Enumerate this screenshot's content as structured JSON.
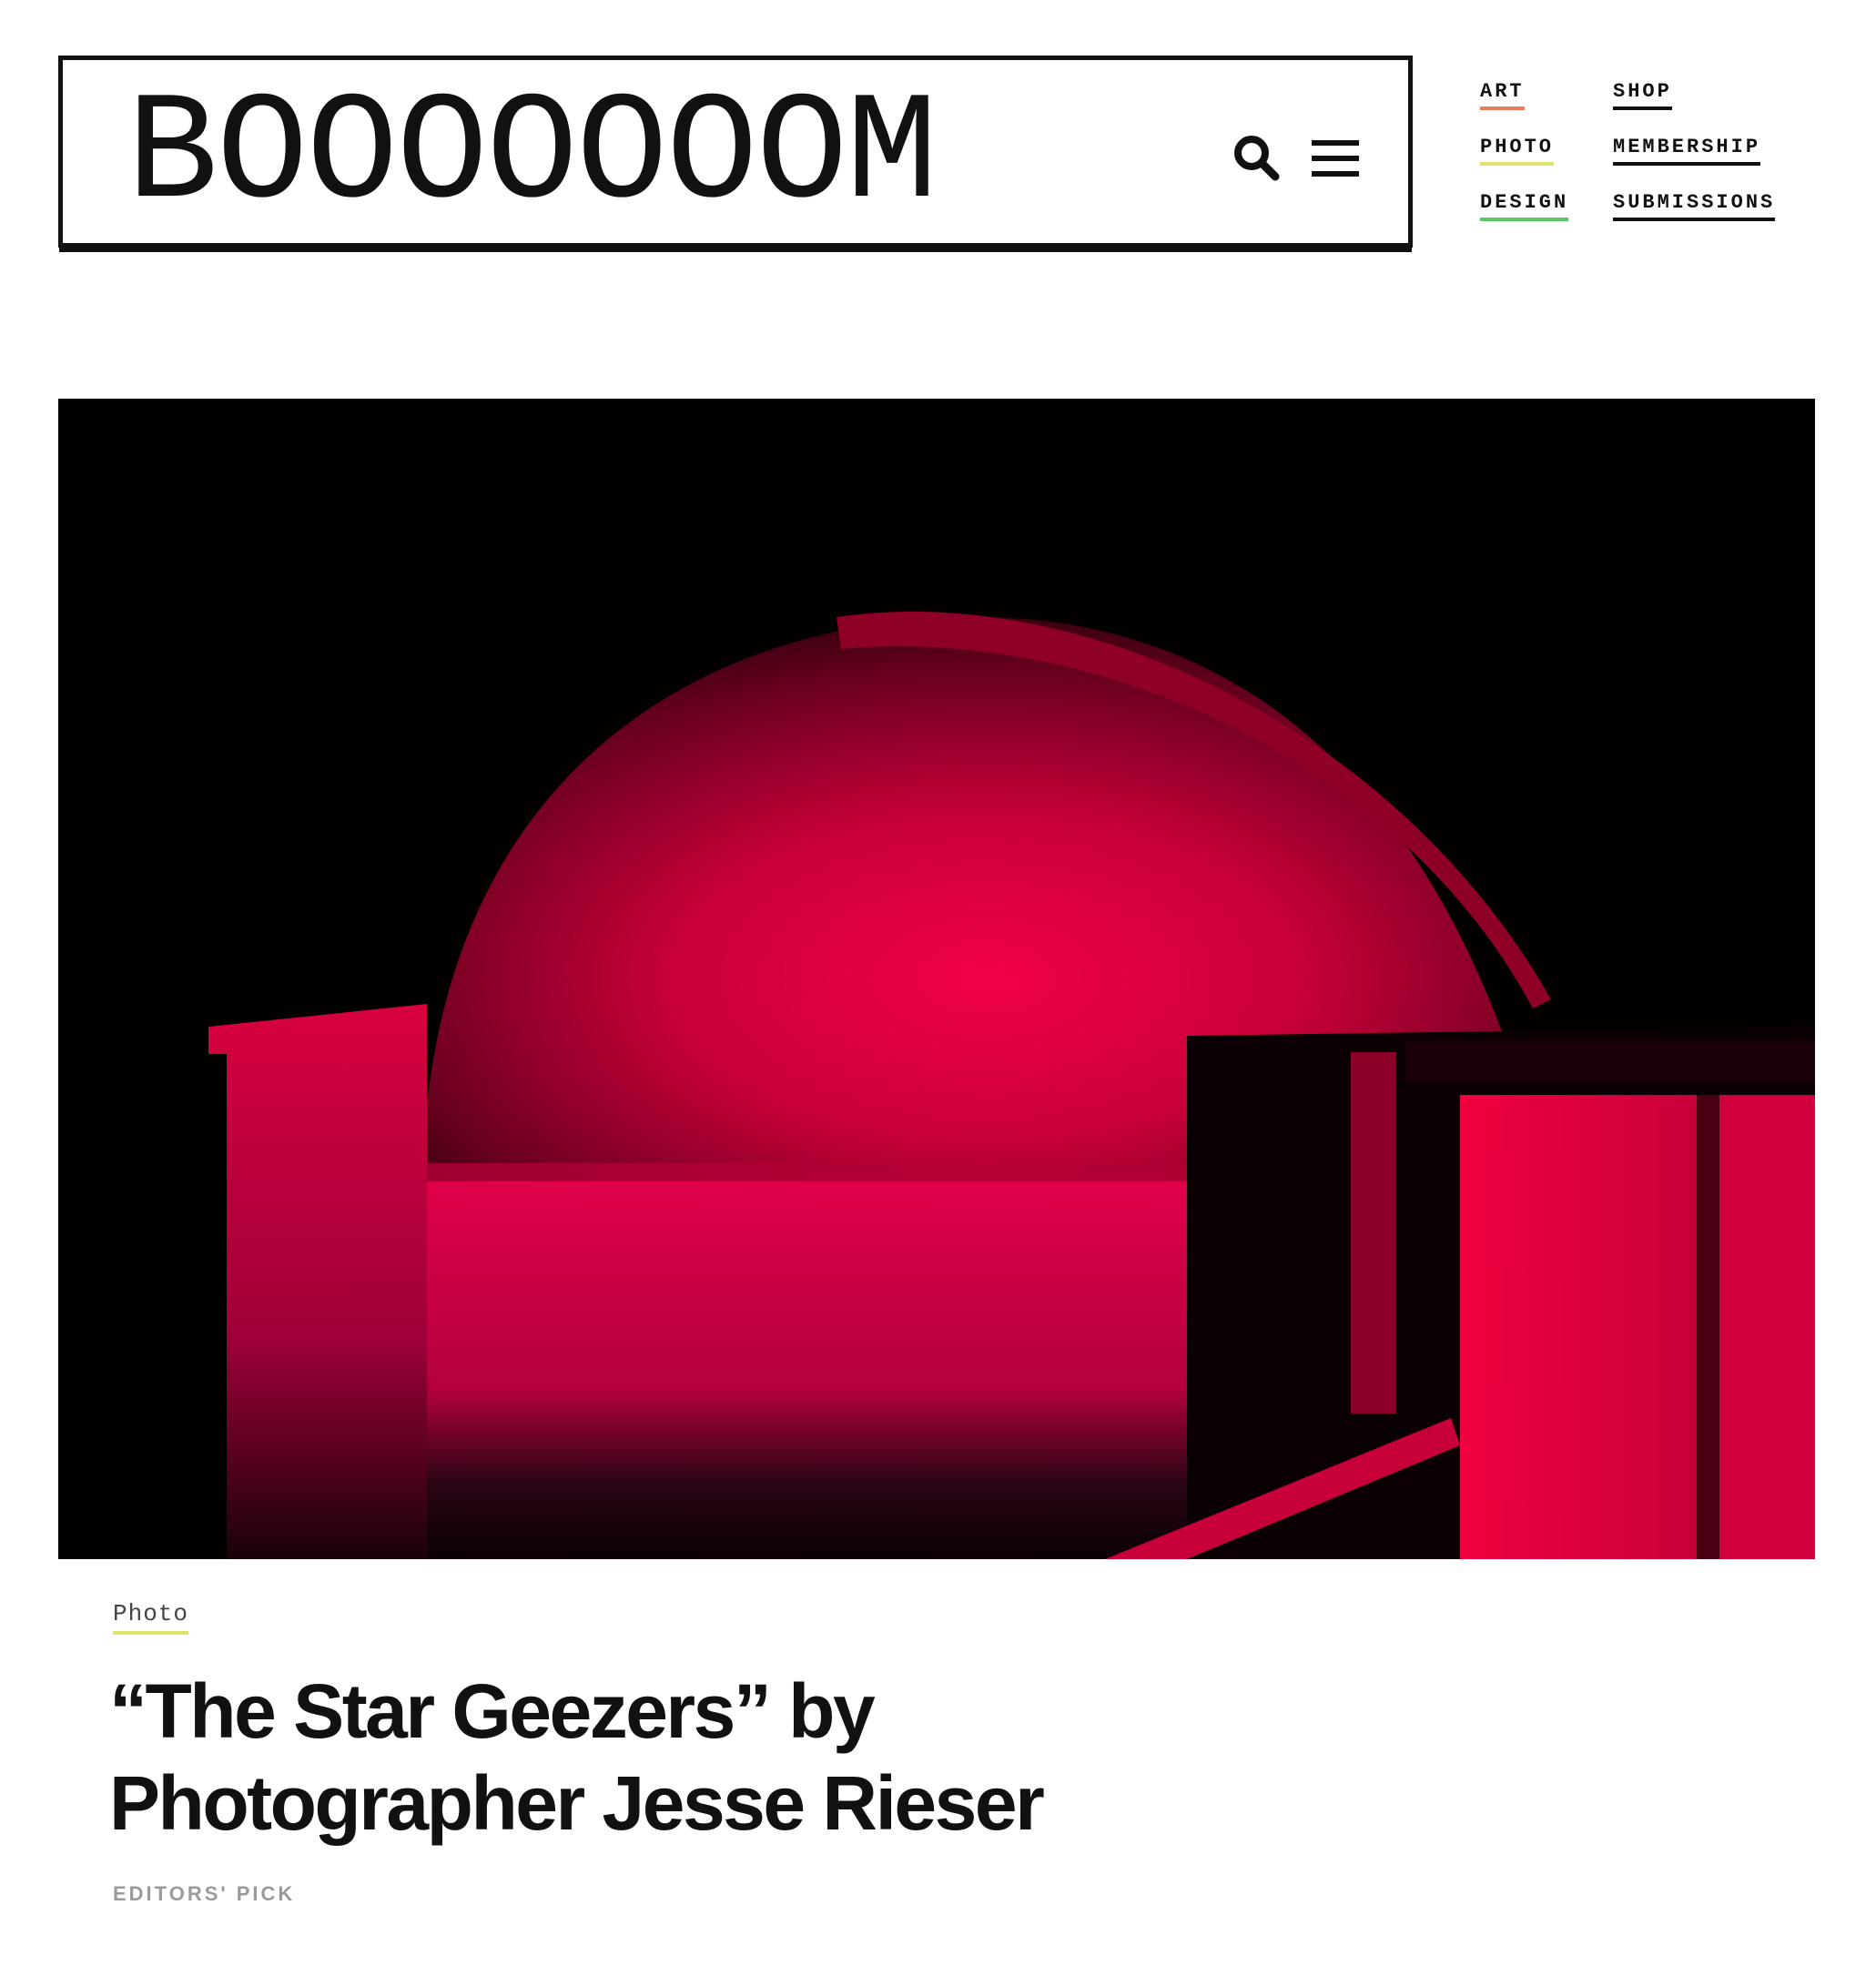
{
  "header": {
    "logo": "BOOOOOOOM",
    "search_icon": "search-icon",
    "menu_icon": "hamburger-menu-icon"
  },
  "nav": {
    "art": {
      "label": "ART",
      "underline_color": "#f07b5a"
    },
    "photo": {
      "label": "PHOTO",
      "underline_color": "#dfe36a"
    },
    "design": {
      "label": "DESIGN",
      "underline_color": "#5dc965"
    },
    "shop": {
      "label": "SHOP",
      "underline_color": "#111111"
    },
    "membership": {
      "label": "MEMBERSHIP",
      "underline_color": "#111111"
    },
    "submissions": {
      "label": "SUBMISSIONS",
      "underline_color": "#111111"
    }
  },
  "article": {
    "category": "Photo",
    "title": "“The Star Geezers” by Photographer Jesse Rieser",
    "tag": "EDITORS' PICK"
  },
  "colors": {
    "category_underline": "#dfe36a",
    "accent_red": "#e8003c"
  }
}
